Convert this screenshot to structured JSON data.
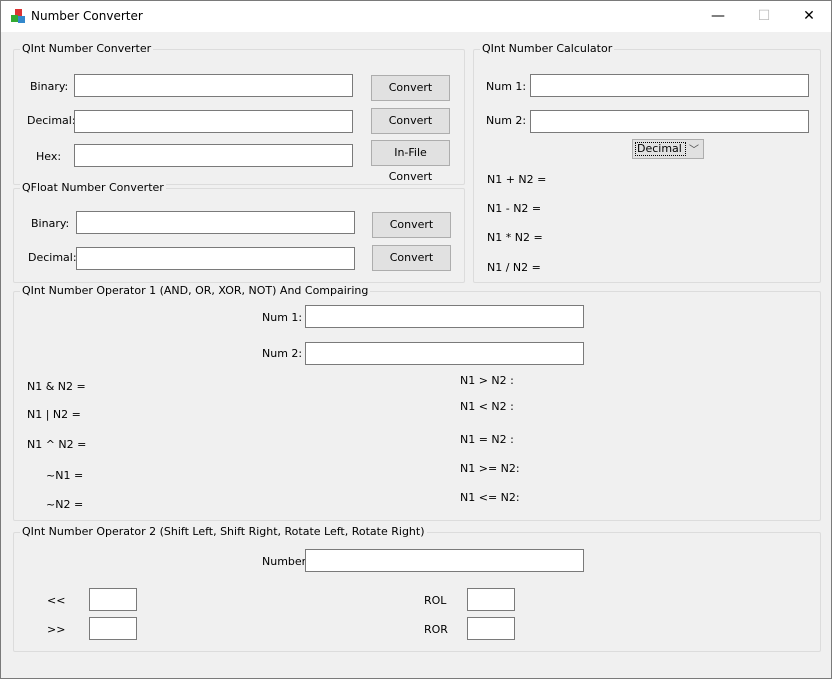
{
  "window": {
    "title": "Number Converter",
    "minimize": "—",
    "maximize": "☐",
    "close": "✕"
  },
  "qint_converter": {
    "title": "QInt Number Converter",
    "binary_label": "Binary:",
    "decimal_label": "Decimal:",
    "hex_label": "Hex:",
    "convert1": "Convert",
    "convert2": "Convert",
    "infile": "In-File Convert",
    "binary_value": "",
    "decimal_value": "",
    "hex_value": ""
  },
  "qfloat_converter": {
    "title": "QFloat Number Converter",
    "binary_label": "Binary:",
    "decimal_label": "Decimal:",
    "convert1": "Convert",
    "convert2": "Convert"
  },
  "calculator": {
    "title": "QInt Number Calculator",
    "num1_label": "Num 1:",
    "num2_label": "Num 2:",
    "mode": "Decimal",
    "add": "N1 + N2 =",
    "sub": "N1 - N2 =",
    "mul": "N1 * N2 =",
    "div": "N1 / N2 ="
  },
  "operator1": {
    "title": "QInt Number Operator 1 (AND, OR, XOR, NOT) And Compairing",
    "num1_label": "Num 1:",
    "num2_label": "Num 2:",
    "and": "N1 & N2 =",
    "or": "N1 | N2 =",
    "xor": "N1 ^ N2 =",
    "not1": "~N1 =",
    "not2": "~N2 =",
    "gt": "N1 > N2 :",
    "lt": "N1 < N2 :",
    "eq": "N1 = N2 :",
    "ge": "N1 >= N2:",
    "le": "N1 <= N2:"
  },
  "operator2": {
    "title": "QInt Number Operator 2 (Shift Left, Shift Right, Rotate Left, Rotate Right)",
    "number_label": "Number:",
    "shl": "<<",
    "shr": ">>",
    "rol": "ROL",
    "ror": "ROR"
  }
}
